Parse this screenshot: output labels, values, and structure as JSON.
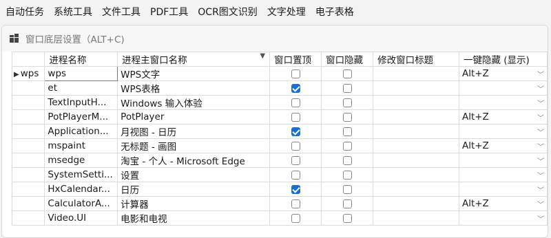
{
  "menubar": [
    "自动任务",
    "系统工具",
    "文件工具",
    "PDF工具",
    "OCR图文识别",
    "文字处理",
    "电子表格"
  ],
  "panel": {
    "title": "窗口底层设置（ALT+C)"
  },
  "columns": [
    "进程名称",
    "进程主窗口名称",
    "窗口置顶",
    "窗口隐藏",
    "修改窗口标题",
    "一键隐藏 (显示)"
  ],
  "selected_row_header": "wps",
  "rows": [
    {
      "process": "wps",
      "window": "WPS文字",
      "top": false,
      "hide": false,
      "title": "",
      "hotkey": "Alt+Z"
    },
    {
      "process": "et",
      "window": "WPS表格",
      "top": true,
      "hide": false,
      "title": "",
      "hotkey": ""
    },
    {
      "process": "TextInputH...",
      "window": "Windows 输入体验",
      "top": false,
      "hide": false,
      "title": "",
      "hotkey": ""
    },
    {
      "process": "PotPlayerM...",
      "window": "PotPlayer",
      "top": false,
      "hide": false,
      "title": "",
      "hotkey": "Alt+Z"
    },
    {
      "process": "Application...",
      "window": "月视图 - 日历",
      "top": true,
      "hide": false,
      "title": "",
      "hotkey": ""
    },
    {
      "process": "mspaint",
      "window": "无标题 - 画图",
      "top": false,
      "hide": false,
      "title": "",
      "hotkey": "Alt+Z"
    },
    {
      "process": "msedge",
      "window": "淘宝 - 个人 - Microsoft Edge",
      "top": false,
      "hide": false,
      "title": "",
      "hotkey": ""
    },
    {
      "process": "SystemSetti...",
      "window": "设置",
      "top": false,
      "hide": false,
      "title": "",
      "hotkey": ""
    },
    {
      "process": "HxCalendar...",
      "window": "日历",
      "top": true,
      "hide": false,
      "title": "",
      "hotkey": ""
    },
    {
      "process": "CalculatorA...",
      "window": "计算器",
      "top": false,
      "hide": false,
      "title": "",
      "hotkey": "Alt+Z"
    },
    {
      "process": "Video.UI",
      "window": "电影和电视",
      "top": false,
      "hide": false,
      "title": "",
      "hotkey": ""
    }
  ]
}
